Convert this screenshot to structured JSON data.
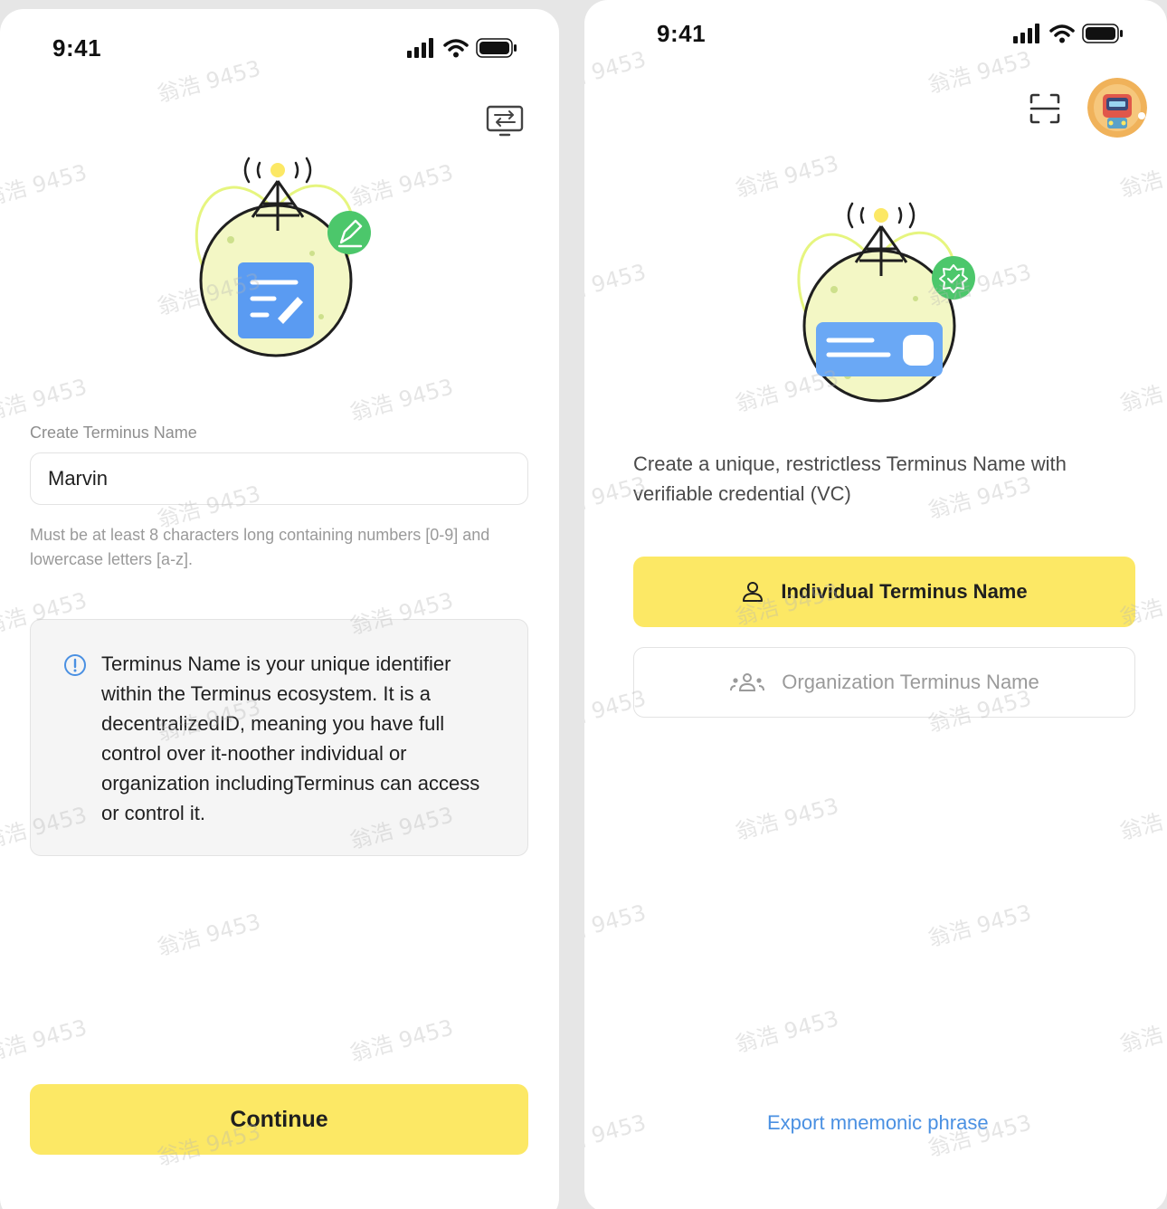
{
  "left": {
    "status": {
      "time": "9:41"
    },
    "field_label": "Create Terminus Name",
    "name_input": {
      "value": "Marvin",
      "placeholder": ""
    },
    "hint": "Must be at least 8 characters long containing numbers [0-9] and lowercase letters [a-z].",
    "info": "Terminus Name is your unique identifier within the Terminus ecosystem. It is a decentralizedID, meaning you have full control over it-noother individual or organization includingTerminus can access or control it.",
    "continue_label": "Continue",
    "icons": {
      "switch": "keyboard-switch-icon",
      "info": "info-icon"
    }
  },
  "right": {
    "status": {
      "time": "9:41"
    },
    "description": "Create a unique, restrictless Terminus Name with verifiable credential (VC)",
    "individual_label": "Individual Terminus Name",
    "organization_label": "Organization Terminus Name",
    "export_label": "Export mnemonic phrase",
    "icons": {
      "scan": "scan-icon",
      "avatar": "avatar",
      "person": "person-icon",
      "group": "group-icon"
    }
  },
  "watermark_text": "翁浩 9453",
  "colors": {
    "accent_yellow": "#fce865",
    "link_blue": "#4a90e2",
    "badge_green": "#4cc76b"
  }
}
